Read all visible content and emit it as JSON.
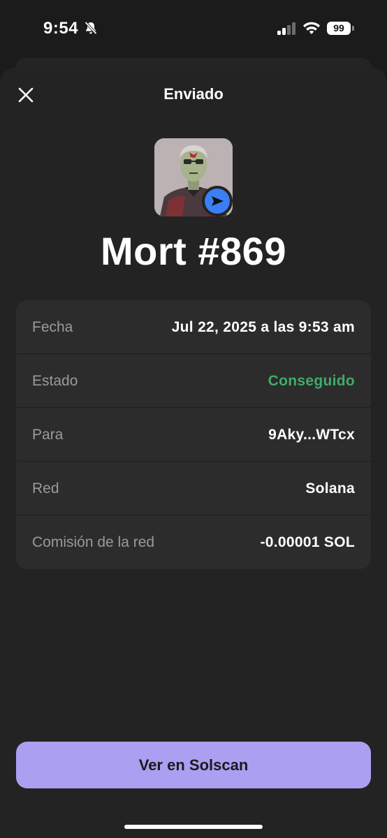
{
  "status_bar": {
    "time": "9:54",
    "battery": "99"
  },
  "sheet": {
    "title": "Enviado"
  },
  "nft": {
    "name": "Mort #869"
  },
  "details": [
    {
      "label": "Fecha",
      "value": "Jul 22, 2025 a las 9:53 am",
      "status": "normal"
    },
    {
      "label": "Estado",
      "value": "Conseguido",
      "status": "success"
    },
    {
      "label": "Para",
      "value": "9Aky...WTcx",
      "status": "normal"
    },
    {
      "label": "Red",
      "value": "Solana",
      "status": "normal"
    },
    {
      "label": "Comisión de la red",
      "value": "-0.00001 SOL",
      "status": "normal"
    }
  ],
  "actions": {
    "view_label": "Ver en Solscan"
  },
  "colors": {
    "accent": "#ab9ff2",
    "success": "#3fab6a",
    "send_badge": "#3b7ff5",
    "background": "#1b1b1b"
  },
  "icons": [
    "bell-slash-icon",
    "signal-icon",
    "wifi-icon",
    "battery-icon",
    "close-icon",
    "send-icon"
  ]
}
